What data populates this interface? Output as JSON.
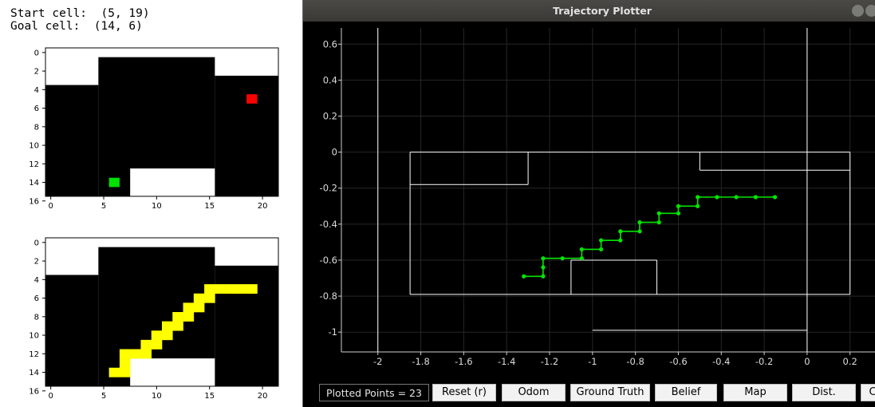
{
  "info": {
    "start_line": "Start cell:  (5, 19)",
    "goal_line": "Goal cell:  (14, 6)"
  },
  "window": {
    "title": "Trajectory Plotter"
  },
  "toolbar": {
    "points_label": "Plotted Points = 23",
    "buttons": [
      "Reset (r)",
      "Odom",
      "Ground Truth",
      "Belief",
      "Map",
      "Dist.",
      "C"
    ]
  },
  "colors": {
    "path_green": "#00e600",
    "map_outline": "#ffffff",
    "start_marker": "#00e000",
    "goal_marker": "#ff0000",
    "planned_path": "#ffff00"
  },
  "chart_data": [
    {
      "type": "heatmap",
      "title": "",
      "grid_rows": 16,
      "grid_cols": 22,
      "free_space_color": "#000000",
      "obstacle_color": "#ffffff",
      "x_ticks": [
        0,
        5,
        10,
        15,
        20
      ],
      "y_ticks": [
        0,
        2,
        4,
        6,
        8,
        10,
        12,
        14,
        16
      ],
      "xlim": [
        -0.5,
        21.5
      ],
      "ylim": [
        15.5,
        -0.5
      ],
      "free_rects": [
        {
          "row0": 0.5,
          "row1": 15.5,
          "col0": 4.5,
          "col1": 15.5
        },
        {
          "row0": 3.5,
          "row1": 15.5,
          "col0": -0.5,
          "col1": 4.5
        },
        {
          "row0": 2.5,
          "row1": 15.5,
          "col0": 15.5,
          "col1": 21.5
        }
      ],
      "obstacle_rects": [
        {
          "row0": 12.5,
          "row1": 15.5,
          "col0": 7.5,
          "col1": 15.5
        }
      ],
      "markers": [
        {
          "label": "goal",
          "row": 5,
          "col": 19,
          "color": "#ff0000"
        },
        {
          "label": "start",
          "row": 14,
          "col": 6,
          "color": "#00e000"
        }
      ]
    },
    {
      "type": "heatmap",
      "title": "",
      "grid_rows": 16,
      "grid_cols": 22,
      "free_space_color": "#000000",
      "obstacle_color": "#ffffff",
      "x_ticks": [
        0,
        5,
        10,
        15,
        20
      ],
      "y_ticks": [
        0,
        2,
        4,
        6,
        8,
        10,
        12,
        14,
        16
      ],
      "xlim": [
        -0.5,
        21.5
      ],
      "ylim": [
        15.5,
        -0.5
      ],
      "free_rects": [
        {
          "row0": 0.5,
          "row1": 15.5,
          "col0": 4.5,
          "col1": 15.5
        },
        {
          "row0": 3.5,
          "row1": 15.5,
          "col0": -0.5,
          "col1": 4.5
        },
        {
          "row0": 2.5,
          "row1": 15.5,
          "col0": 15.5,
          "col1": 21.5
        }
      ],
      "obstacle_rects": [
        {
          "row0": 12.5,
          "row1": 15.5,
          "col0": 7.5,
          "col1": 15.5
        }
      ],
      "path_color": "#ffff00",
      "path_cells": [
        [
          14,
          6
        ],
        [
          14,
          7
        ],
        [
          13,
          7
        ],
        [
          12,
          7
        ],
        [
          12,
          8
        ],
        [
          12,
          9
        ],
        [
          11,
          9
        ],
        [
          11,
          10
        ],
        [
          10,
          10
        ],
        [
          10,
          11
        ],
        [
          9,
          11
        ],
        [
          9,
          12
        ],
        [
          8,
          12
        ],
        [
          8,
          13
        ],
        [
          7,
          13
        ],
        [
          7,
          14
        ],
        [
          6,
          14
        ],
        [
          6,
          15
        ],
        [
          5,
          15
        ],
        [
          5,
          16
        ],
        [
          5,
          17
        ],
        [
          5,
          18
        ],
        [
          5,
          19
        ]
      ]
    },
    {
      "type": "line",
      "title": "",
      "xlabel": "",
      "ylabel": "",
      "xlim": [
        -2.17,
        0.32
      ],
      "ylim": [
        -1.11,
        0.69
      ],
      "x_ticks": [
        -2,
        -1.8,
        -1.6,
        -1.4,
        -1.2,
        -1,
        -0.8,
        -0.6,
        -0.4,
        -0.2,
        0,
        0.2
      ],
      "x_tick_labels": [
        "-2",
        "-1.8",
        "-1.6",
        "-1.4",
        "-1.2",
        "-1",
        "-0.8",
        "-0.6",
        "-0.4",
        "-0.2",
        "0",
        "0.2"
      ],
      "y_ticks": [
        0.6,
        0.4,
        0.2,
        0,
        -0.2,
        -0.4,
        -0.6,
        -0.8,
        -1
      ],
      "y_tick_labels": [
        "0.6",
        "0.4",
        "0.2",
        "0",
        "-0.2",
        "-0.4",
        "-0.6",
        "-0.8",
        "-1"
      ],
      "grid": true,
      "map_segments": [
        [
          [
            -1.85,
            0
          ],
          [
            0.2,
            0
          ]
        ],
        [
          [
            -1.85,
            0
          ],
          [
            -1.85,
            -0.79
          ]
        ],
        [
          [
            -1.85,
            -0.79
          ],
          [
            0.2,
            -0.79
          ]
        ],
        [
          [
            0.2,
            0
          ],
          [
            0.2,
            -0.79
          ]
        ],
        [
          [
            -1.85,
            -0.18
          ],
          [
            -1.3,
            -0.18
          ]
        ],
        [
          [
            -1.3,
            0
          ],
          [
            -1.3,
            -0.18
          ]
        ],
        [
          [
            -0.5,
            0
          ],
          [
            -0.5,
            -0.1
          ]
        ],
        [
          [
            -0.5,
            -0.1
          ],
          [
            0.2,
            -0.1
          ]
        ],
        [
          [
            -1.1,
            -0.6
          ],
          [
            -0.7,
            -0.6
          ]
        ],
        [
          [
            -1.1,
            -0.6
          ],
          [
            -1.1,
            -0.79
          ]
        ],
        [
          [
            -0.7,
            -0.6
          ],
          [
            -0.7,
            -0.79
          ]
        ],
        [
          [
            -1,
            -0.99
          ],
          [
            0,
            -0.99
          ]
        ],
        [
          [
            -2,
            0.69
          ],
          [
            -2,
            -1.11
          ]
        ],
        [
          [
            0,
            0.69
          ],
          [
            0,
            -1.11
          ]
        ]
      ],
      "series": [
        {
          "color": "#00e600",
          "x": [
            -1.32,
            -1.23,
            -1.23,
            -1.23,
            -1.14,
            -1.05,
            -1.05,
            -0.96,
            -0.96,
            -0.87,
            -0.87,
            -0.78,
            -0.78,
            -0.69,
            -0.69,
            -0.6,
            -0.6,
            -0.51,
            -0.51,
            -0.42,
            -0.33,
            -0.24,
            -0.15
          ],
          "y": [
            -0.69,
            -0.69,
            -0.64,
            -0.59,
            -0.59,
            -0.59,
            -0.54,
            -0.54,
            -0.49,
            -0.49,
            -0.44,
            -0.44,
            -0.39,
            -0.39,
            -0.34,
            -0.34,
            -0.3,
            -0.3,
            -0.25,
            -0.25,
            -0.25,
            -0.25,
            -0.25
          ]
        }
      ]
    }
  ]
}
